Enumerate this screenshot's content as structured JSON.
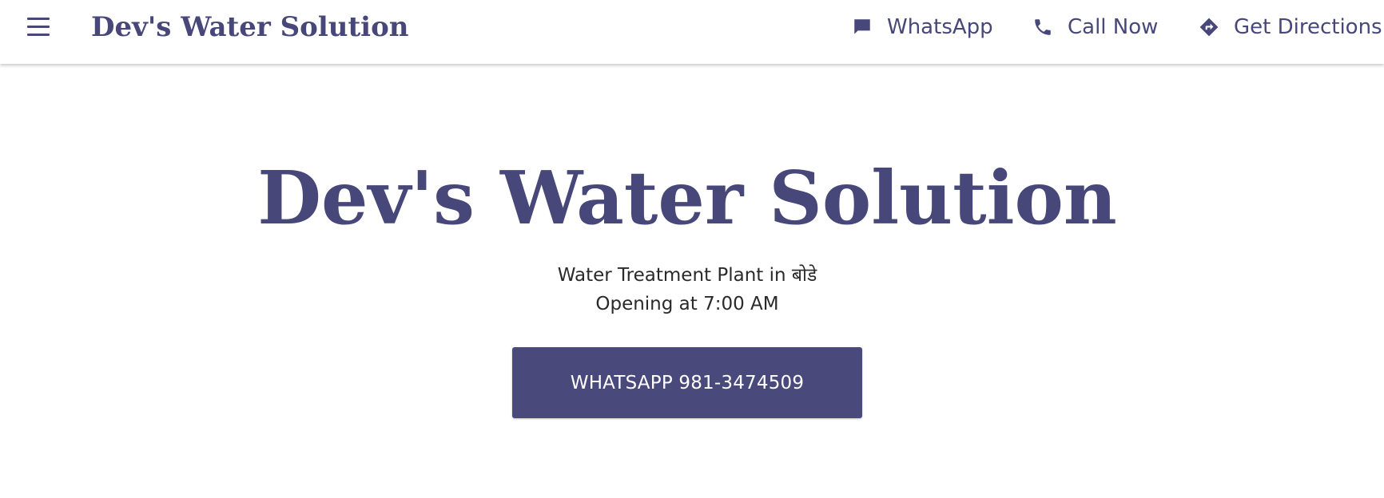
{
  "header": {
    "brand": "Dev's Water Solution",
    "actions": [
      {
        "label": "WhatsApp",
        "icon": "chat-icon"
      },
      {
        "label": "Call Now",
        "icon": "phone-icon"
      },
      {
        "label": "Get Directions",
        "icon": "directions-icon"
      }
    ]
  },
  "hero": {
    "title": "Dev's Water Solution",
    "subtitle": "Water Treatment Plant in बोडे",
    "hours": "Opening at 7:00 AM",
    "cta_label": "WHATSAPP 981-3474509"
  },
  "colors": {
    "brand": "#47477a",
    "button_bg": "#4a497c",
    "button_text": "#ffffff"
  }
}
